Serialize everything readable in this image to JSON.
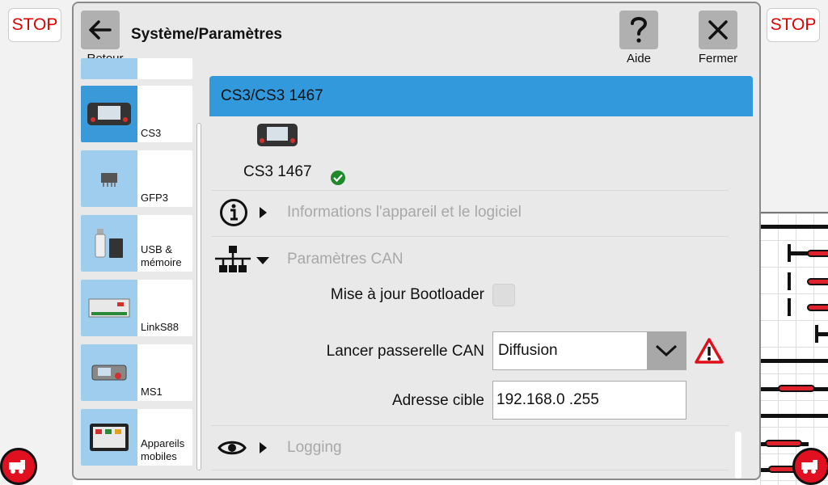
{
  "window": {
    "title": "Système/Paramètres",
    "back_label": "Retour",
    "help_label": "Aide",
    "close_label": "Fermer"
  },
  "stop": {
    "left_label": "STOP",
    "right_label": "STOP"
  },
  "sidebar": {
    "items": [
      {
        "label": "CS3",
        "icon": "cs3-device-icon",
        "active": true
      },
      {
        "label": "GFP3",
        "icon": "gfp3-chip-icon",
        "active": false
      },
      {
        "label": "USB & mémoire",
        "icon": "usb-memory-icon",
        "active": false
      },
      {
        "label": "LinkS88",
        "icon": "links88-module-icon",
        "active": false
      },
      {
        "label": "MS1",
        "icon": "ms1-controller-icon",
        "active": false
      },
      {
        "label": "Appareils mobiles",
        "icon": "mobile-devices-icon",
        "active": false
      }
    ]
  },
  "device": {
    "header": "CS3/CS3 1467",
    "name": "CS3 1467",
    "status": "ok"
  },
  "sections": {
    "info_label": "Informations l'appareil et le logiciel",
    "can_label": "Paramètres CAN",
    "logging_label": "Logging"
  },
  "can_settings": {
    "bootloader_label": "Mise à jour Bootloader",
    "bootloader_checked": false,
    "gateway_label": "Lancer passerelle CAN",
    "gateway_value": "Diffusion",
    "target_label": "Adresse cible",
    "target_value": "192.168.0  .255"
  },
  "colors": {
    "accent": "#3399dd",
    "sidebar_thumb": "#9ecdee",
    "stop_text": "#e00000",
    "warning": "#e0101a",
    "ok": "#1e8a2c"
  }
}
